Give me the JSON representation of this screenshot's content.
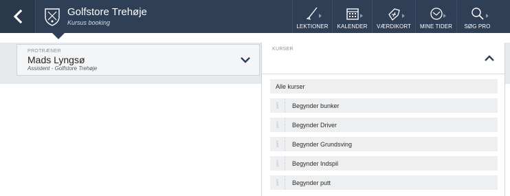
{
  "header": {
    "title": "Golfstore Trehøje",
    "subtitle": "Kursus booking",
    "nav": [
      {
        "label": "LEKTIONER",
        "icon": "golf-club-icon"
      },
      {
        "label": "KALENDER",
        "icon": "calendar-icon"
      },
      {
        "label": "VÆRDIKORT",
        "icon": "value-card-icon"
      },
      {
        "label": "MINE TIDER",
        "icon": "my-times-icon"
      },
      {
        "label": "SØG PRO",
        "icon": "search-icon"
      }
    ]
  },
  "trainer": {
    "label": "PROTRÆNER",
    "name": "Mads Lyngsø",
    "role": "Assistent - Golfstore Trehøje"
  },
  "courses": {
    "label": "KURSER",
    "items": [
      "Alle kurser",
      "Begynder bunker",
      "Begynder Driver",
      "Begynder Grundsving",
      "Begynder Indspil",
      "Begynder putt"
    ]
  },
  "colors": {
    "header_bg": "#2f3f55",
    "content_bg": "#e6e9ec",
    "item_bg": "#edeff1"
  }
}
